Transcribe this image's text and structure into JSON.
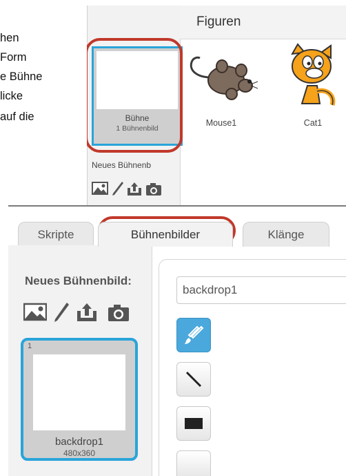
{
  "instruction_lines": [
    "hen",
    "Form",
    "e Bühne",
    "licke",
    "auf die"
  ],
  "top_panel": {
    "sprites_title": "Figuren",
    "stage": {
      "name": "Bühne",
      "count": "1 Bühnenbild"
    },
    "new_backdrop_label": "Neues Bühnenb",
    "sprites": [
      {
        "name": "Mouse1",
        "icon": "mouse-sprite-icon"
      },
      {
        "name": "Cat1",
        "icon": "cat-sprite-icon"
      }
    ]
  },
  "bottom_panel": {
    "tabs": [
      {
        "label": "Skripte",
        "active": false
      },
      {
        "label": "Bühnenbilder",
        "active": true
      },
      {
        "label": "Klänge",
        "active": false
      }
    ],
    "new_backdrop_label": "Neues Bühnenbild:",
    "backdrop_name_value": "backdrop1",
    "backdrop": {
      "index": "1",
      "name": "backdrop1",
      "size": "480x360"
    },
    "tools": [
      "brush-icon",
      "line-icon",
      "rectangle-icon"
    ]
  },
  "colors": {
    "selection_blue": "#2aa4d9",
    "highlight_red": "#c0392b",
    "panel_gray": "#f2f2f2"
  }
}
